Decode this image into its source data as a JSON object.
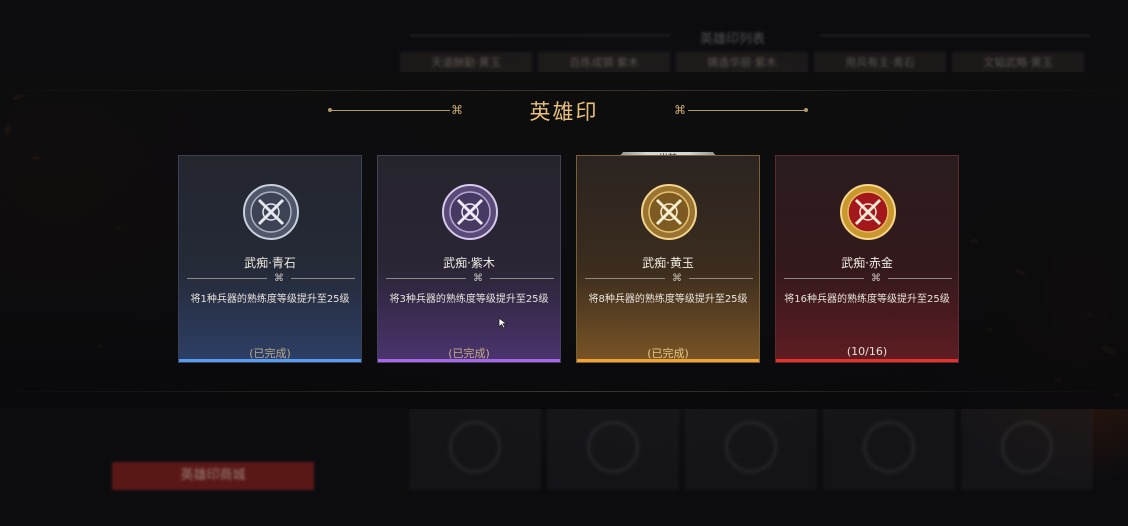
{
  "background": {
    "list_title": "英雄印列表",
    "tabs": [
      "天道酬勤·黄玉",
      "百炼成钢·紫木",
      "铸造华丽·紫木",
      "用兵有主·青石",
      "文韬武略·黄玉"
    ],
    "shop_button": "英雄印商城"
  },
  "dialog": {
    "title": "英雄印",
    "current_badge": "当前",
    "cards": [
      {
        "name": "武痴·青石",
        "desc": "将1种兵器的熟练度等级提升至25级",
        "status": "(已完成)",
        "tier": "blue",
        "accent": "#5a9cf0"
      },
      {
        "name": "武痴·紫木",
        "desc": "将3种兵器的熟练度等级提升至25级",
        "status": "(已完成)",
        "tier": "purple",
        "accent": "#a46ae6"
      },
      {
        "name": "武痴·黄玉",
        "desc": "将8种兵器的熟练度等级提升至25级",
        "status": "(已完成)",
        "tier": "gold",
        "accent": "#f0a234"
      },
      {
        "name": "武痴·赤金",
        "desc": "将16种兵器的熟练度等级提升至25级",
        "status": "(10/16)",
        "tier": "red",
        "accent": "#e2342d"
      }
    ]
  }
}
